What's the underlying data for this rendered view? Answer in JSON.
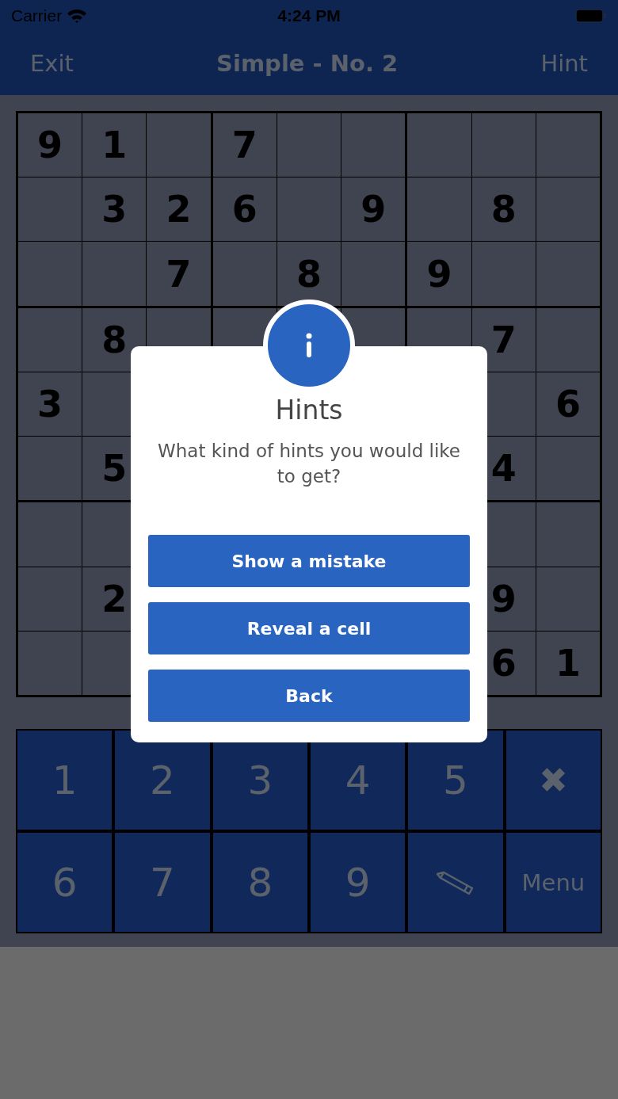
{
  "status_bar": {
    "carrier": "Carrier",
    "time": "4:24 PM"
  },
  "nav": {
    "left": "Exit",
    "title": "Simple - No. 2",
    "right": "Hint"
  },
  "grid": {
    "rows": [
      [
        "9",
        "1",
        null,
        "7",
        null,
        null,
        null,
        null,
        null
      ],
      [
        null,
        "3",
        "2",
        "6",
        null,
        "9",
        null,
        "8",
        null
      ],
      [
        null,
        null,
        "7",
        null,
        "8",
        null,
        "9",
        null,
        null
      ],
      [
        null,
        "8",
        null,
        null,
        null,
        null,
        null,
        "7",
        null
      ],
      [
        "3",
        null,
        null,
        null,
        null,
        null,
        null,
        null,
        "6"
      ],
      [
        null,
        "5",
        null,
        null,
        null,
        null,
        null,
        "4",
        null
      ],
      [
        null,
        null,
        null,
        null,
        null,
        null,
        null,
        null,
        null
      ],
      [
        null,
        "2",
        null,
        null,
        null,
        null,
        null,
        "9",
        null
      ],
      [
        null,
        null,
        null,
        null,
        null,
        null,
        null,
        "6",
        "1"
      ]
    ]
  },
  "keypad": [
    {
      "kind": "digit",
      "label": "1"
    },
    {
      "kind": "digit",
      "label": "2"
    },
    {
      "kind": "digit",
      "label": "3"
    },
    {
      "kind": "digit",
      "label": "4"
    },
    {
      "kind": "digit",
      "label": "5"
    },
    {
      "kind": "erase",
      "label": "✖"
    },
    {
      "kind": "digit",
      "label": "6"
    },
    {
      "kind": "digit",
      "label": "7"
    },
    {
      "kind": "digit",
      "label": "8"
    },
    {
      "kind": "digit",
      "label": "9"
    },
    {
      "kind": "pencil"
    },
    {
      "kind": "menu",
      "label": "Menu"
    }
  ],
  "dialog": {
    "title": "Hints",
    "message": "What kind of hints you would like to get?",
    "buttons": [
      "Show a mistake",
      "Reveal a cell",
      "Back"
    ]
  }
}
